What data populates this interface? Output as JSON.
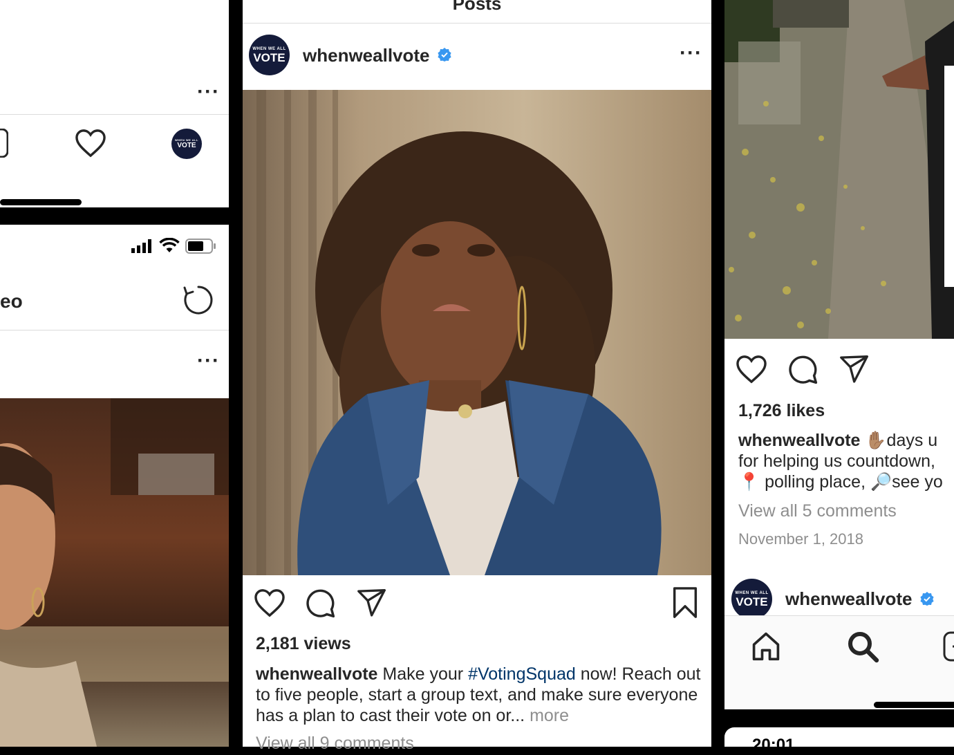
{
  "accent": "#3897f0",
  "link_color": "#003569",
  "avatar": {
    "top": "WHEN WE ALL",
    "main": "VOTE",
    "bg": "#141b3a"
  },
  "left_top": {
    "home_indicator": true
  },
  "left_bottom": {
    "title_partial": "eo",
    "status_icons": [
      "signal-icon",
      "wifi-icon",
      "battery-icon"
    ]
  },
  "center": {
    "header_title": "Posts",
    "username": "whenweallvote",
    "views": "2,181 views",
    "caption_user": "whenweallvote",
    "caption_pre": "Make your",
    "caption_hashtag": "#VotingSquad",
    "caption_post": "now! Reach out to five people, start a group text, and make sure everyone has a plan to cast their vote on or...",
    "more": "more",
    "comments_link": "View all 9 comments"
  },
  "right": {
    "likes": "1,726 likes",
    "caption_user": "whenweallvote",
    "caption_line1": "✋🏽days u",
    "caption_line2": "for helping us countdown,",
    "caption_line3": "📍 polling place, 🔎see yo",
    "comments_link": "View all 5 comments",
    "date": "November 1, 2018",
    "next_username": "whenweallvote",
    "next_time": "20:01"
  }
}
